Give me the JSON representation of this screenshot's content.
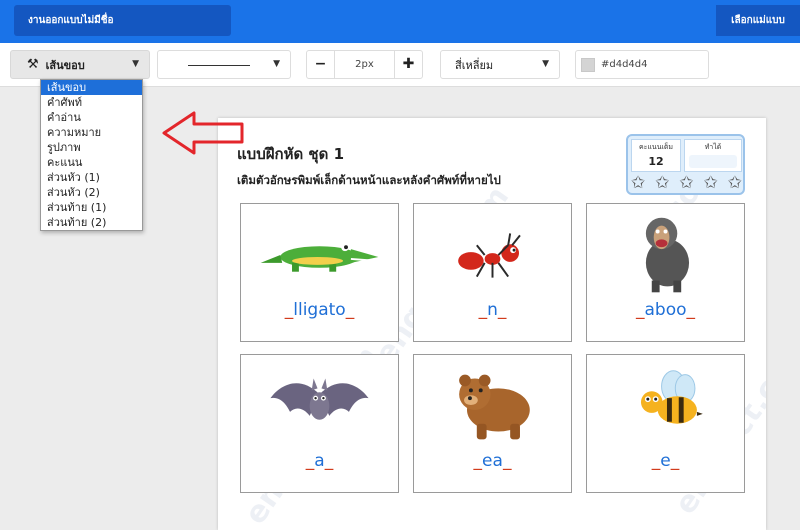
{
  "header": {
    "title": "งานออกแบบไม่มีชื่อ",
    "pick_template": "เลือกแม่แบบ"
  },
  "toolbar": {
    "border_label": "เส้นขอบ",
    "width_value": "2px",
    "shape_value": "สี่เหลี่ยม",
    "color_value": "#d4d4d4"
  },
  "dropdown": {
    "items": [
      "เส้นขอบ",
      "คำศัพท์",
      "คำอ่าน",
      "ความหมาย",
      "รูปภาพ",
      "คะแนน",
      "ส่วนหัว (1)",
      "ส่วนหัว (2)",
      "ส่วนท้าย (1)",
      "ส่วนท้าย (2)"
    ],
    "selected_index": 0
  },
  "worksheet": {
    "title": "แบบฝึกหัด ชุด 1",
    "instruction": "เติมตัวอักษรพิมพ์เล็กด้านหน้าและหลังคำศัพท์ที่หายไป",
    "watermark": "engdict.com",
    "score": {
      "full_label": "คะแนนเต็ม",
      "full_value": "12",
      "got_label": "ทำได้",
      "stars": 5
    },
    "cards": [
      {
        "animal": "crocodile",
        "word": "lligato"
      },
      {
        "animal": "ant",
        "word": "n"
      },
      {
        "animal": "baboon",
        "word": "aboo"
      },
      {
        "animal": "bat",
        "word": "a"
      },
      {
        "animal": "bear",
        "word": "ea"
      },
      {
        "animal": "bee",
        "word": "e"
      }
    ]
  },
  "colors": {
    "header_bg": "#1a73e8",
    "header_dark": "#1457c1",
    "dropdown_selected": "#1e6fd9",
    "arrow": "#e3262b",
    "word_blue": "#1f6fd6",
    "blank_red": "#d23b1c"
  }
}
